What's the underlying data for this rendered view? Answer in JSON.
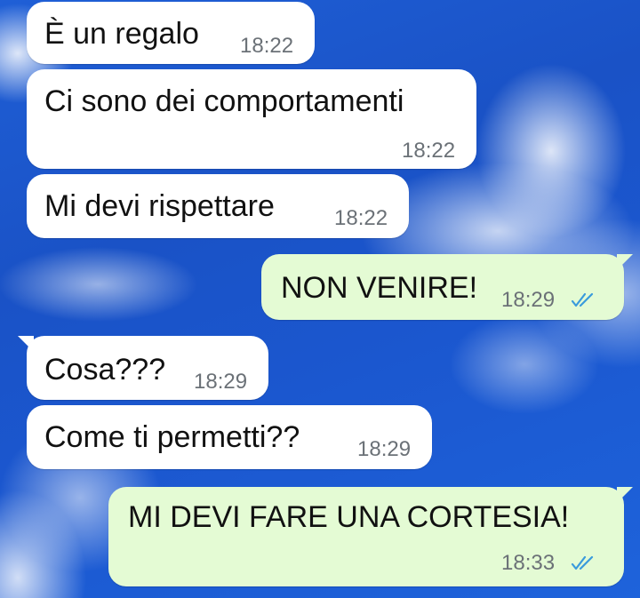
{
  "chat": {
    "messages": [
      {
        "direction": "incoming",
        "text": "È un regalo",
        "time": "18:22"
      },
      {
        "direction": "incoming",
        "text": "Ci sono dei comportamenti",
        "time": "18:22"
      },
      {
        "direction": "incoming",
        "text": "Mi devi rispettare",
        "time": "18:22"
      },
      {
        "direction": "outgoing",
        "text": "NON VENIRE!",
        "time": "18:29",
        "status": "read"
      },
      {
        "direction": "incoming",
        "text": "Cosa???",
        "time": "18:29"
      },
      {
        "direction": "incoming",
        "text": "Come ti permetti??",
        "time": "18:29"
      },
      {
        "direction": "outgoing",
        "text": "MI DEVI FARE UNA CORTESIA!",
        "time": "18:33",
        "status": "read"
      }
    ]
  },
  "colors": {
    "incoming_bubble": "#ffffff",
    "outgoing_bubble": "#e4fbd4",
    "read_ticks": "#3a9bdc",
    "wallpaper_sky": "#1b57cf"
  },
  "icons": {
    "read_receipt": "double-check-icon",
    "wallpaper": "blue-sky-clouds"
  }
}
